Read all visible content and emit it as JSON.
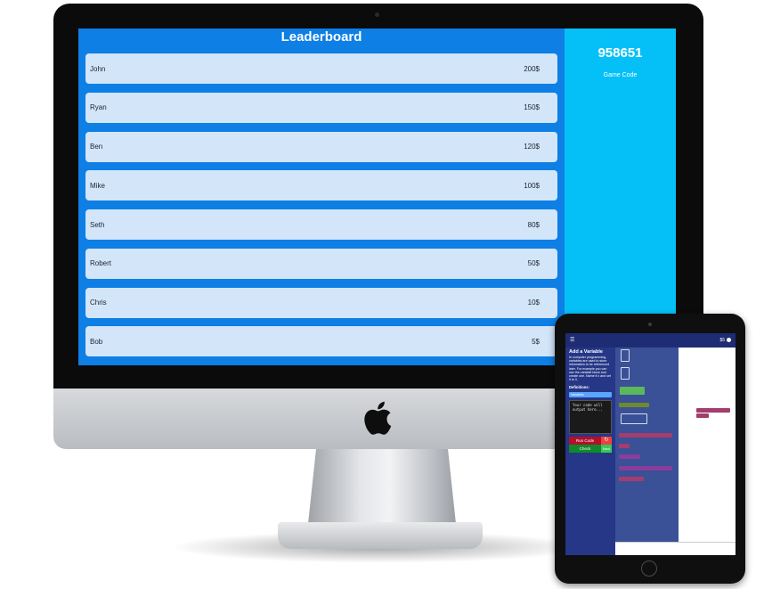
{
  "leaderboard": {
    "title": "Leaderboard",
    "rows": [
      {
        "name": "John",
        "score": "200$"
      },
      {
        "name": "Ryan",
        "score": "150$"
      },
      {
        "name": "Ben",
        "score": "120$"
      },
      {
        "name": "Mike",
        "score": "100$"
      },
      {
        "name": "Seth",
        "score": "80$"
      },
      {
        "name": "Robert",
        "score": "50$"
      },
      {
        "name": "Chris",
        "score": "10$"
      },
      {
        "name": "Bob",
        "score": "5$"
      }
    ]
  },
  "game_code": {
    "value": "958651",
    "label": "Game Code"
  },
  "tablet": {
    "menu_icon": "menu-icon",
    "balance": "$5",
    "lesson": {
      "title": "Add a Variable",
      "text": "In computer programming, variables are used to store information to be referenced later. For example you can use the variable block and create one. Name it x and set it to 3.",
      "definitions_title": "Definitions:",
      "definition_chip": "Variables",
      "output_placeholder": "Your code will output here..."
    },
    "buttons": {
      "run": "Run Code",
      "check": "Check",
      "next": "Next"
    }
  },
  "colors": {
    "leaderboard_bg": "#0d7fe5",
    "row_bg": "#d3e5f9",
    "code_panel_bg": "#05c0f7",
    "tablet_sidebar": "#263787",
    "tablet_toolbox": "#3a5097"
  }
}
